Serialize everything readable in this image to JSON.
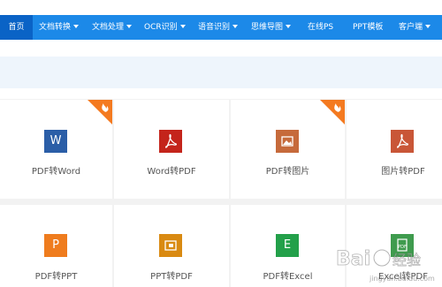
{
  "nav": {
    "items": [
      {
        "label": "首页",
        "active": true,
        "dropdown": false
      },
      {
        "label": "文档转换",
        "active": false,
        "dropdown": true
      },
      {
        "label": "文档处理",
        "active": false,
        "dropdown": true
      },
      {
        "label": "OCR识别",
        "active": false,
        "dropdown": true
      },
      {
        "label": "语音识别",
        "active": false,
        "dropdown": true
      },
      {
        "label": "思维导图",
        "active": false,
        "dropdown": true
      },
      {
        "label": "在线PS",
        "active": false,
        "dropdown": false
      },
      {
        "label": "PPT模板",
        "active": false,
        "dropdown": false
      },
      {
        "label": "客户端",
        "active": false,
        "dropdown": true
      }
    ]
  },
  "tools": {
    "row1": [
      {
        "label": "PDF转Word",
        "icon": "word-icon",
        "glyph": "W",
        "color": "#2b5ea7",
        "hot": true
      },
      {
        "label": "Word转PDF",
        "icon": "pdf-icon",
        "color": "#c4241b",
        "hot": false
      },
      {
        "label": "PDF转图片",
        "icon": "image-icon",
        "color": "#c66a3b",
        "hot": true
      },
      {
        "label": "图片转PDF",
        "icon": "pdf-icon",
        "color": "#c95637",
        "hot": false
      }
    ],
    "row2": [
      {
        "label": "PDF转PPT",
        "icon": "ppt-icon",
        "glyph": "P",
        "color": "#ef7c1e",
        "hot": false
      },
      {
        "label": "PPT转PDF",
        "icon": "slides-icon",
        "color": "#d98a12",
        "hot": false
      },
      {
        "label": "PDF转Excel",
        "icon": "excel-icon",
        "glyph": "E",
        "color": "#23a04a",
        "hot": false
      },
      {
        "label": "Excel转PDF",
        "icon": "excel-pdf-icon",
        "color": "#3f9b4e",
        "hot": false
      }
    ]
  },
  "colors": {
    "nav_bg": "#1c89e8",
    "nav_active": "#0a63c6",
    "hot_badge": "#f47a20"
  },
  "watermark": {
    "text": "Bai",
    "suffix": "经验",
    "sub": "jingyan.baidu.com"
  }
}
